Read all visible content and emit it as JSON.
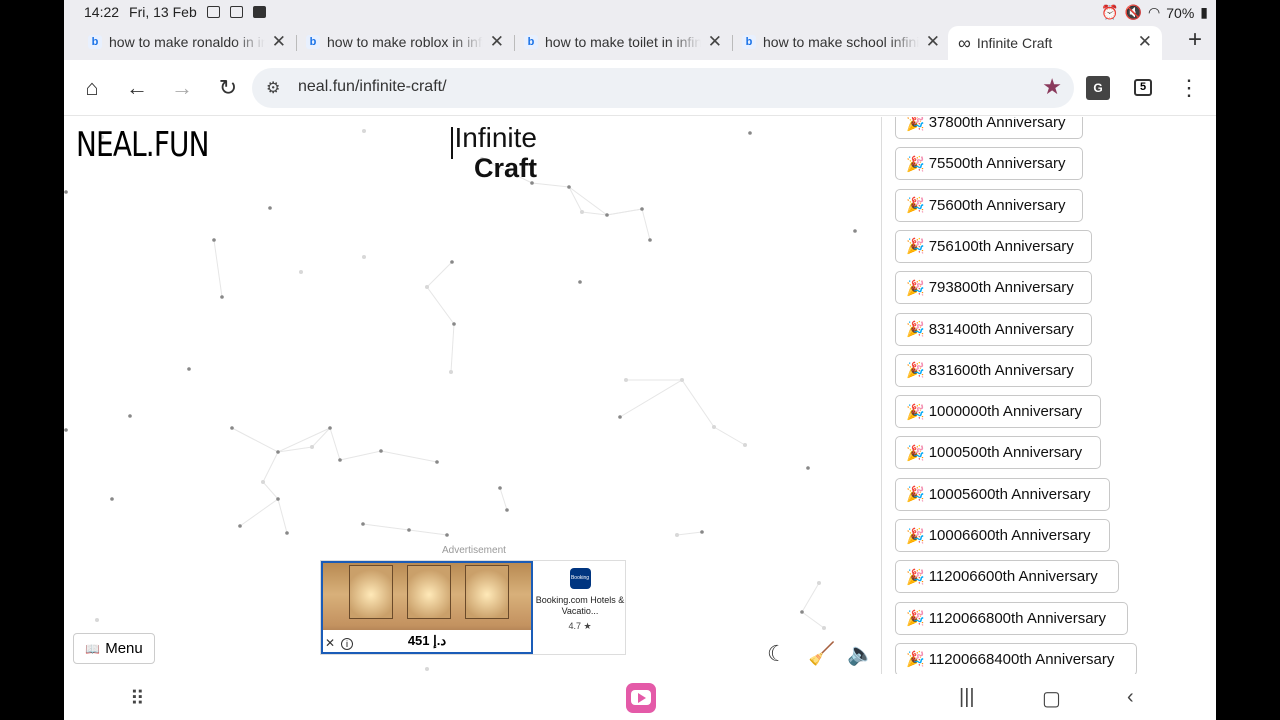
{
  "status": {
    "time": "14:22",
    "date": "Fri, 13 Feb",
    "battery": "70%"
  },
  "tabs": [
    {
      "title": "how to make ronaldo in infinite craft",
      "favicon": "bing"
    },
    {
      "title": "how to make roblox in infinite craft",
      "favicon": "bing"
    },
    {
      "title": "how to make toilet in infinite craft",
      "favicon": "bing"
    },
    {
      "title": "how to make school infinite craft",
      "favicon": "bing"
    },
    {
      "title": "Infinite Craft",
      "favicon": "infinity",
      "active": true
    }
  ],
  "toolbar": {
    "url": "neal.fun/infinite-craft/",
    "tab_count": "5"
  },
  "page": {
    "logo": "NEAL.FUN",
    "title_line1": "Infinite",
    "title_line2": "Craft",
    "ad_label": "Advertisement",
    "ad": {
      "price": "451 د.إ",
      "brand": "Booking.com",
      "brand_logo": "Booking",
      "description": "Booking.com Hotels & Vacatio...",
      "rating": "4.7 ★"
    },
    "menu_label": "Menu"
  },
  "sidebar": {
    "emoji": "🎉",
    "items": [
      "37800th Anniversary",
      "75500th Anniversary",
      "75600th Anniversary",
      "756100th Anniversary",
      "793800th Anniversary",
      "831400th Anniversary",
      "831600th Anniversary",
      "1000000th Anniversary",
      "1000500th Anniversary",
      "10005600th Anniversary",
      "10006600th Anniversary",
      "112006600th Anniversary",
      "1120066800th Anniversary",
      "11200668400th Anniversary"
    ]
  }
}
